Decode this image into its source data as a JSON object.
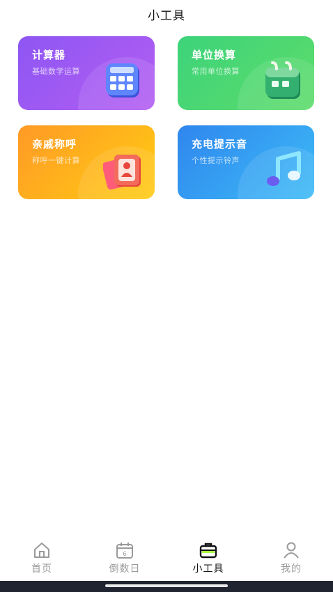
{
  "header": {
    "title": "小工具"
  },
  "tools": [
    {
      "title": "计算器",
      "subtitle": "基础数学运算",
      "icon": "calculator-icon"
    },
    {
      "title": "单位换算",
      "subtitle": "常用单位换算",
      "icon": "calendar-icon"
    },
    {
      "title": "亲戚称呼",
      "subtitle": "称呼一键计算",
      "icon": "contact-card-icon"
    },
    {
      "title": "充电提示音",
      "subtitle": "个性提示铃声",
      "icon": "music-note-icon"
    }
  ],
  "tabbar": {
    "active": "小工具",
    "items": [
      {
        "label": "首页",
        "icon": "home-icon"
      },
      {
        "label": "倒数日",
        "icon": "calendar-6-icon",
        "badge_text": "6"
      },
      {
        "label": "小工具",
        "icon": "toolbox-icon"
      },
      {
        "label": "我的",
        "icon": "user-icon"
      }
    ]
  },
  "colors": {
    "calculator_card": "#8e56f3",
    "unit_card": "#3dd37a",
    "relatives_card": "#ff9a26",
    "ringtone_card": "#2f86ee",
    "tab_active": "#111111",
    "tab_inactive": "#9a9a9a",
    "tool_icon_accent": "#a8ff3e"
  }
}
